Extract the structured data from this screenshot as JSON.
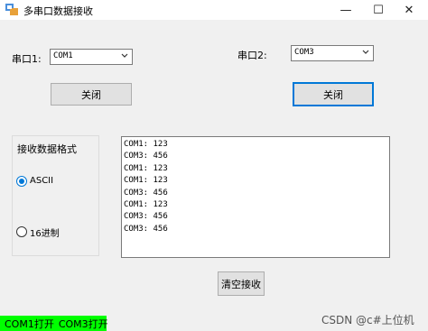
{
  "window": {
    "title": "多串口数据接收",
    "controls": {
      "minimize": "—",
      "maximize": "☐",
      "close": "✕"
    }
  },
  "port1": {
    "label": "串口1:",
    "value": "COM1",
    "button": "关闭"
  },
  "port2": {
    "label": "串口2:",
    "value": "COM3",
    "button": "关闭"
  },
  "format_group": {
    "title": "接收数据格式",
    "options": [
      {
        "label": "ASCII",
        "checked": true
      },
      {
        "label": "16进制",
        "checked": false
      }
    ]
  },
  "receive": {
    "lines": [
      "COM1: 123",
      "COM3: 456",
      "COM1: 123",
      "COM1: 123",
      "COM3: 456",
      "COM1: 123",
      "COM3: 456",
      "COM3: 456"
    ]
  },
  "clear_button": "清空接收",
  "status": {
    "port1": "COM1打开",
    "port2": "COM3打开"
  },
  "watermark": "CSDN @c#上位机",
  "colors": {
    "status_bg": "#00ff00",
    "accent": "#0078d7"
  }
}
